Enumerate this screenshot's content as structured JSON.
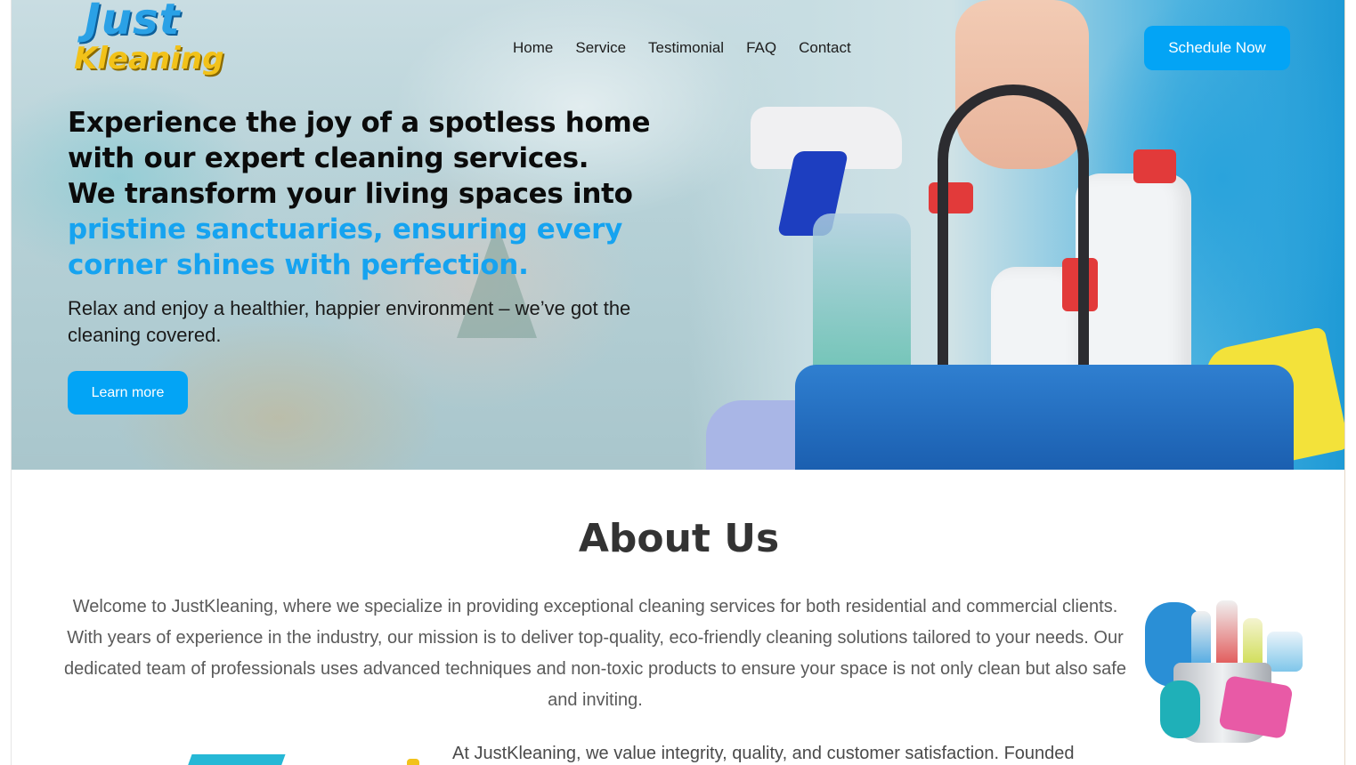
{
  "brand": {
    "logo_line1": "Just",
    "logo_line2": "Kleaning"
  },
  "nav": {
    "items": [
      "Home",
      "Service",
      "Testimonial",
      "FAQ",
      "Contact"
    ]
  },
  "header": {
    "cta_label": "Schedule Now"
  },
  "hero": {
    "headline_part1": "Experience the joy of a spotless home with our expert cleaning services.",
    "headline_part2": "We transform your living spaces into",
    "headline_highlight": "pristine sanctuaries, ensuring every corner shines with perfection.",
    "subtext": "Relax and enjoy a healthier, happier environment – we’ve got the cleaning covered.",
    "button_label": "Learn more"
  },
  "about": {
    "title": "About Us",
    "paragraph1": "Welcome to JustKleaning, where we specialize in providing exceptional cleaning services for both residential and commercial clients. With years of experience in the industry, our mission is to deliver top-quality, eco-friendly cleaning solutions tailored to your needs. Our dedicated team of professionals uses advanced techniques and non-toxic products to ensure your space is not only clean but also safe and inviting.",
    "paragraph2": "At JustKleaning, we value integrity, quality, and customer satisfaction. Founded"
  },
  "colors": {
    "accent": "#03a4f5",
    "headline_highlight": "#16a3f0",
    "logo_blue": "#2aa1e6",
    "logo_yellow": "#f2c21a"
  },
  "icons": {
    "hero_image": "cleaning-supplies-basket-photo",
    "about_image": "cleaning-supplies-bucket-illustration"
  }
}
